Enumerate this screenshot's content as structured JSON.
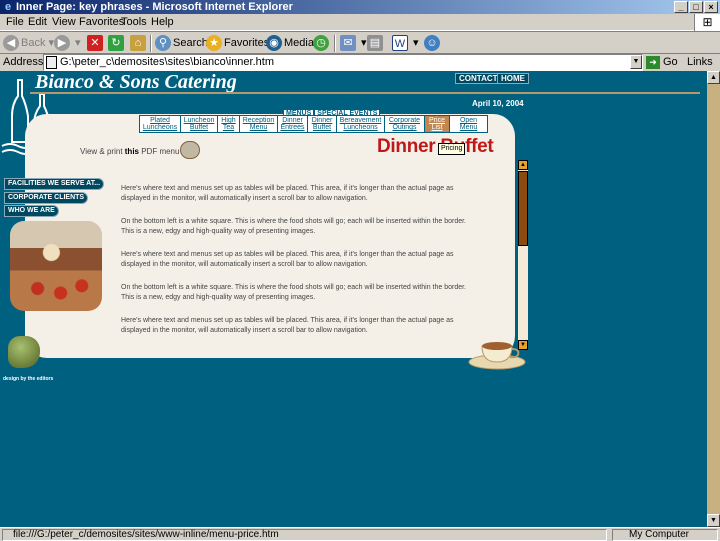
{
  "window": {
    "title": "Inner Page: key phrases - Microsoft Internet Explorer",
    "controls": [
      "_",
      "□",
      "×"
    ]
  },
  "menubar": {
    "items": [
      "File",
      "Edit",
      "View",
      "Favorites",
      "Tools",
      "Help"
    ]
  },
  "toolbar": {
    "back": "Back",
    "search": "Search",
    "favorites": "Favorites",
    "media": "Media"
  },
  "address": {
    "label": "Address",
    "value": "G:\\peter_c\\demosites\\sites\\bianco\\inner.htm",
    "go": "Go",
    "links": "Links"
  },
  "site": {
    "title": "Bianco & Sons Catering",
    "topnav": [
      "CONTACT",
      "HOME"
    ],
    "date": "April 10, 2004",
    "menu_tabs": [
      "MENUS",
      "SPECIAL EVENTS"
    ],
    "categories": [
      {
        "line1": "Plated",
        "line2": "Luncheons"
      },
      {
        "line1": "Luncheon",
        "line2": "Buffet"
      },
      {
        "line1": "High",
        "line2": "Tea"
      },
      {
        "line1": "Reception",
        "line2": "Menu"
      },
      {
        "line1": "Dinner",
        "line2": "Entrees"
      },
      {
        "line1": "Dinner",
        "line2": "Buffet"
      },
      {
        "line1": "Bereavement",
        "line2": "Luncheons"
      },
      {
        "line1": "Corporate",
        "line2": "Outings"
      },
      {
        "line1": "Price",
        "line2": "List"
      },
      {
        "line1": "Open",
        "line2": "Menu"
      }
    ],
    "pdf_prefix": "View & print ",
    "pdf_bold": "this",
    "pdf_suffix": " PDF menu",
    "headline": "Dinner Buffet",
    "tooltip": "Pricing",
    "paragraphs": [
      "Here's where text and menus set up as tables will be placed. This area, if it's longer than the actual page as displayed in the monitor, will automatically insert a scroll bar to allow navigation.",
      "On the bottom left is a white square. This is where the food shots will go; each will be inserted within the border. This is a new, edgy and high-quality way of presenting images.",
      "Here's where text and menus set up as tables will be placed. This area, if it's longer than the actual page as displayed in the monitor, will automatically insert a scroll bar to allow navigation.",
      "On the bottom left is a white square. This is where the food shots will go; each will be inserted within the border. This is a new, edgy and high-quality way of presenting images.",
      "Here's where text and menus set up as tables will be placed. This area, if it's longer than the actual page as displayed in the monitor, will automatically insert a scroll bar to allow navigation."
    ],
    "sidenav": [
      "FACILITIES WE SERVE AT...",
      "CORPORATE CLIENTS",
      "WHO WE ARE"
    ],
    "credit": "design by the editors"
  },
  "status": {
    "text": "file:///G:/peter_c/demosites/sites/www-inline/menu-price.htm",
    "zone": "My Computer"
  },
  "colors": {
    "page_bg": "#006080",
    "headline": "#c01818",
    "accent": "#c08850"
  }
}
